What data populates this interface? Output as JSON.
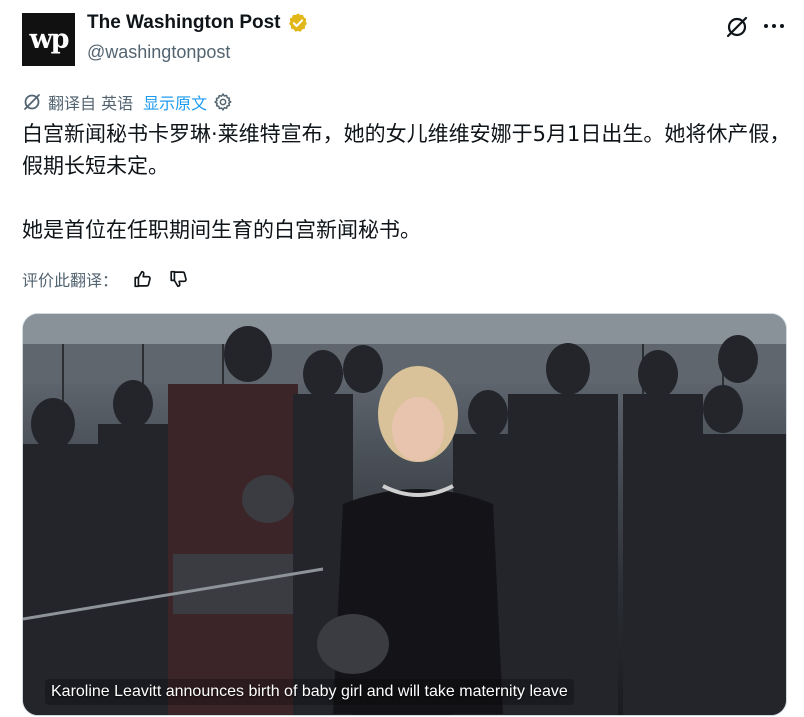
{
  "author": {
    "name": "The Washington Post",
    "handle": "@washingtonpost",
    "avatar_text": "wp",
    "verified_color": "#e2b719"
  },
  "icons": {
    "grok": "grok-icon",
    "more": "more-icon",
    "translate": "translate-icon",
    "settings": "gear-icon",
    "thumbs_up": "thumbs-up-icon",
    "thumbs_down": "thumbs-down-icon"
  },
  "translation": {
    "label": "翻译自 英语",
    "show_original": "显示原文",
    "link_color": "#1d9bf0"
  },
  "tweet": {
    "paragraph1": "白宫新闻秘书卡罗琳·莱维特宣布，她的女儿维维安娜于5月1日出生。她将休产假，假期长短未定。",
    "paragraph2": "她是首位在任职期间生育的白宫新闻秘书。"
  },
  "rating": {
    "label": "评价此翻译："
  },
  "media": {
    "caption": "Karoline Leavitt announces birth of baby girl and will take maternity leave"
  }
}
